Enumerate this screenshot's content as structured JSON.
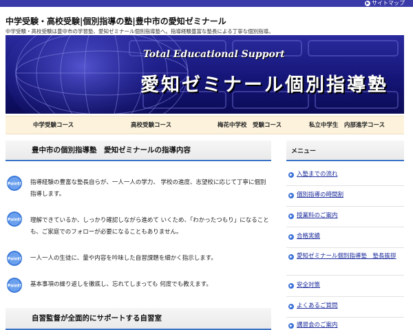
{
  "header": {
    "sitemap_label": "サイトマップ",
    "title": "中学受験・高校受験|個別指導の塾|豊中市の愛知ゼミナール",
    "description": "中学受験・高校受験は豊中市の学習塾、愛知ゼミナール個別指導塾へ。指導経験豊富な塾長による丁寧な個別指導。"
  },
  "banner": {
    "subtitle": "Total Educational Support",
    "main_title": "愛知ゼミナール個別指導塾"
  },
  "nav": {
    "items": [
      "中学受験コース",
      "高校受験コース",
      "梅花中学校　受験コース",
      "私立中学生　内部進学コース"
    ]
  },
  "main": {
    "heading": "豊中市の個別指導塾　愛知ゼミナールの指導内容",
    "points": [
      "指導経験の豊富な塾長自らが、一人一人の学力、 学校の進度、志望校に応じて丁寧に個別指導します。",
      "理解できているか、しっかり確認しながら進めて いくため、「わかったつもり」になることも、ご家庭でのフォローが必要になることもありません。",
      "一人一人の生徒に、量や内容を吟味した自習課題を細かく指示します。",
      "基本事項の繰り返しを徹底し、忘れてしまっても 何度でも教えます。"
    ],
    "point_badge": "Point!",
    "subheading": "自習監督が全面的にサポートする自習室"
  },
  "sidebar": {
    "heading": "メニュー",
    "items": [
      "入塾までの流れ",
      "個別指導の時間割",
      "授業料のご案内",
      "合格実績",
      "愛知ゼミナール個別指導塾　塾長挨拶",
      "安全対策",
      "よくあるご質問",
      "講習会のご案内"
    ]
  },
  "colors": {
    "topbar": "#3a3aa8",
    "banner": "#151578",
    "nav_background": "#fdf3dd",
    "heading_rule": "#3a72c8",
    "link": "#1a2a9a"
  }
}
